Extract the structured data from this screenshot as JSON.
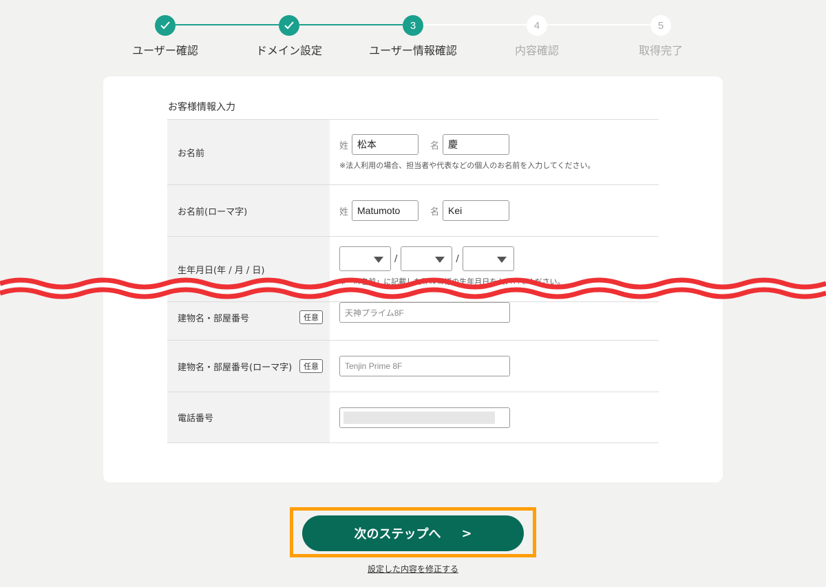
{
  "stepper": {
    "steps": [
      {
        "number": "",
        "label": "ユーザー確認",
        "status": "done",
        "icon": "check-icon"
      },
      {
        "number": "",
        "label": "ドメイン設定",
        "status": "done",
        "icon": "check-icon"
      },
      {
        "number": "3",
        "label": "ユーザー情報確認",
        "status": "current"
      },
      {
        "number": "4",
        "label": "内容確認",
        "status": "todo"
      },
      {
        "number": "5",
        "label": "取得完了",
        "status": "todo"
      }
    ]
  },
  "form": {
    "section_title": "お客様情報入力",
    "name": {
      "label": "お名前",
      "last_prefix": "姓",
      "last_value": "松本",
      "first_prefix": "名",
      "first_value": "慶",
      "note": "※法人利用の場合、担当者や代表などの個人のお名前を入力してください。"
    },
    "name_roman": {
      "label": "お名前(ローマ字)",
      "last_prefix": "姓",
      "last_value": "Matumoto",
      "first_prefix": "名",
      "first_value": "Kei"
    },
    "birthdate": {
      "label": "生年月日(年 / 月 / 日)",
      "separator": "/",
      "note": "※「お名前」に記載した登録者様の生年月日を入力してください。"
    },
    "building": {
      "label": "建物名・部屋番号",
      "badge": "任意",
      "value": "天神プライム8F"
    },
    "building_roman": {
      "label": "建物名・部屋番号(ローマ字)",
      "badge": "任意",
      "value": "Tenjin Prime 8F"
    },
    "phone": {
      "label": "電話番号"
    }
  },
  "actions": {
    "next_label": "次のステップへ",
    "next_chevron": ">",
    "edit_link": "設定した内容を修正する"
  },
  "colors": {
    "accent": "#1aa08c",
    "button": "#076b58",
    "highlight": "#ff9f0a",
    "wave": "#ee3134"
  }
}
